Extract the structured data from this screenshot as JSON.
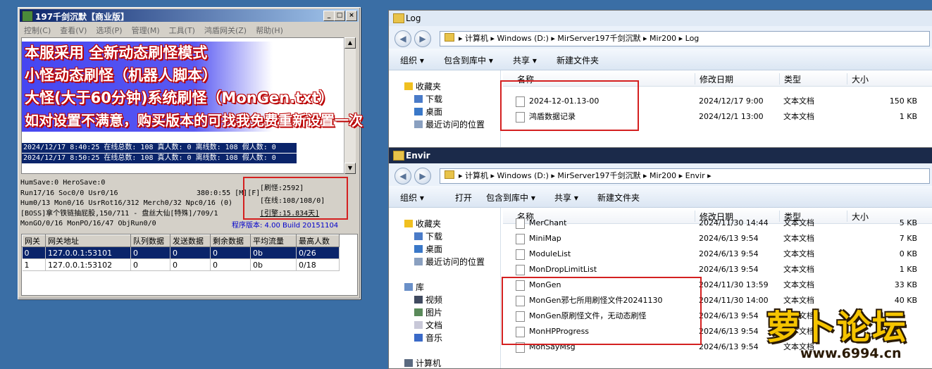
{
  "server_window": {
    "title": "197千剑沉默【商业版】",
    "menu": [
      "控制(C)",
      "查看(V)",
      "选项(P)",
      "管理(M)",
      "工具(T)",
      "鸿盾网关(Z)",
      "帮助(H)"
    ],
    "log_lines": [
      "2024/12/17 8:40:25 在线总数: 108 真人数: 0 离线数: 108 假人数: 0",
      "2024/12/17 8:50:25 在线总数: 108 真人数: 0 离线数: 108 假人数: 0"
    ],
    "status": {
      "line1": "HumSave:0 HeroSave:0",
      "line2a": "Run17/16 Soc0/0 Usr0/16",
      "line2b": "380:0:55 [M][F]",
      "line3": "Hum0/13 Mon0/16 UsrRot16/312 Merch0/32 Npc0/16 (0)",
      "line4": "[BOSS]拿个铁链抽屁股,150/711 - 盘丝大仙[特殊]/709/1",
      "line5": "MonGO/0/16 MonPO/16/47 ObjRun0/0"
    },
    "stats": {
      "refresh": "[刷怪:2592]",
      "online": "[在线:108/108/0]",
      "engine": "[引擎:15.834天]"
    },
    "version": "程序版本: 4.00 Build 20151104",
    "gateway_table": {
      "headers": [
        "网关",
        "网关地址",
        "队列数据",
        "发送数据",
        "剩余数据",
        "平均流量",
        "最高人数"
      ],
      "rows": [
        [
          "0",
          "127.0.0.1:53101",
          "0",
          "0",
          "0",
          "0b",
          "0/26"
        ],
        [
          "1",
          "127.0.0.1:53102",
          "0",
          "0",
          "0",
          "0b",
          "0/18"
        ]
      ]
    }
  },
  "overlay": {
    "line1": "本服采用 全新动态刷怪模式",
    "line2": "小怪动态刷怪（机器人脚本）",
    "line3": "大怪(大于60分钟)系统刷怪（MonGen.txt）",
    "line4": "如对设置不满意，购买版本的可找我免费重新设置一次"
  },
  "log_window": {
    "title": "Log",
    "path": "▸ 计算机 ▸ Windows (D:) ▸ MirServer197千剑沉默 ▸ Mir200 ▸ Log",
    "toolbar": [
      "组织 ▾",
      "包含到库中 ▾",
      "共享 ▾",
      "新建文件夹"
    ],
    "nav": [
      "收藏夹",
      "下载",
      "桌面",
      "最近访问的位置"
    ],
    "columns": [
      "名称",
      "修改日期",
      "类型",
      "大小"
    ],
    "files": [
      {
        "name": "2024-12-01.13-00",
        "date": "2024/12/17 9:00",
        "type": "文本文档",
        "size": "150 KB"
      },
      {
        "name": "鸿盾数据记录",
        "date": "2024/12/1 13:00",
        "type": "文本文档",
        "size": "1 KB"
      }
    ]
  },
  "envir_window": {
    "title": "Envir",
    "path": "▸ 计算机 ▸ Windows (D:) ▸ MirServer197千剑沉默 ▸ Mir200 ▸ Envir ▸",
    "toolbar": [
      "组织 ▾",
      "打开",
      "包含到库中 ▾",
      "共享 ▾",
      "新建文件夹"
    ],
    "nav": [
      "收藏夹",
      "下载",
      "桌面",
      "最近访问的位置",
      "库",
      "视频",
      "图片",
      "文档",
      "音乐",
      "计算机"
    ],
    "columns": [
      "名称",
      "修改日期",
      "类型",
      "大小"
    ],
    "files": [
      {
        "name": "MerChant",
        "date": "2024/11/30 14:44",
        "type": "文本文档",
        "size": "5 KB"
      },
      {
        "name": "MiniMap",
        "date": "2024/6/13 9:54",
        "type": "文本文档",
        "size": "7 KB"
      },
      {
        "name": "ModuleList",
        "date": "2024/6/13 9:54",
        "type": "文本文档",
        "size": "0 KB"
      },
      {
        "name": "MonDropLimitList",
        "date": "2024/6/13 9:54",
        "type": "文本文档",
        "size": "1 KB"
      },
      {
        "name": "MonGen",
        "date": "2024/11/30 13:59",
        "type": "文本文档",
        "size": "33 KB"
      },
      {
        "name": "MonGen邪七所用刷怪文件20241130",
        "date": "2024/11/30 14:00",
        "type": "文本文档",
        "size": "40 KB"
      },
      {
        "name": "MonGen原刷怪文件，无动态刷怪",
        "date": "2024/6/13 9:54",
        "type": "文本文档",
        "size": ""
      },
      {
        "name": "MonHPProgress",
        "date": "2024/6/13 9:54",
        "type": "文本文档",
        "size": ""
      },
      {
        "name": "MonSayMsg",
        "date": "2024/6/13 9:54",
        "type": "文本文档",
        "size": ""
      }
    ]
  },
  "watermark": {
    "brand": "萝卜论坛",
    "url": "www.6994.cn"
  },
  "colors": {
    "desktop": "#3a6ea5",
    "title_active": "#0a246a",
    "highlight_box": "#d42020",
    "logo": "#f5c400"
  }
}
